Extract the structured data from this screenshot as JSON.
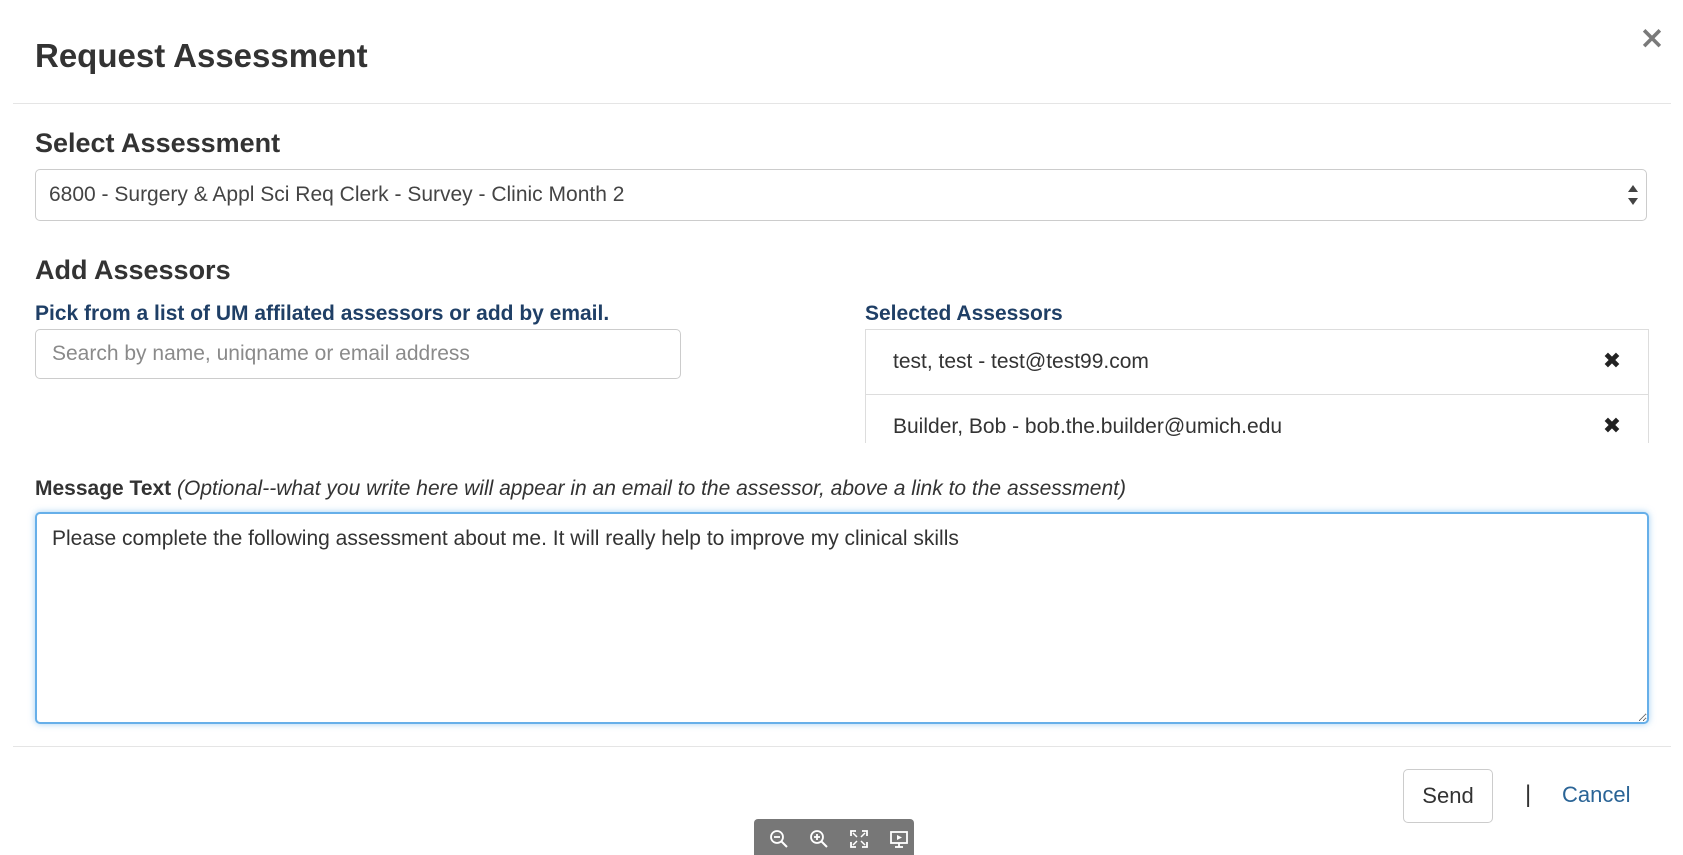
{
  "modal": {
    "title": "Request Assessment",
    "close_label": "×"
  },
  "assessment": {
    "heading": "Select Assessment",
    "selected": "6800 - Surgery & Appl Sci Req Clerk - Survey - Clinic Month 2"
  },
  "assessors": {
    "heading": "Add Assessors",
    "search_label": "Pick from a list of UM affilated assessors or add by email.",
    "search_placeholder": "Search by name, uniqname or email address",
    "selected_label": "Selected Assessors",
    "selected": [
      {
        "text": "test, test - test@test99.com",
        "remove_label": "✖"
      },
      {
        "text": "Builder, Bob - bob.the.builder@umich.edu",
        "remove_label": "✖"
      }
    ]
  },
  "message": {
    "label": "Message Text",
    "hint": "(Optional--what you write here will appear in an email to the assessor, above a link to the assessment)",
    "value": "Please complete the following assessment about me. It will really help to improve my clinical skills"
  },
  "footer": {
    "send_label": "Send",
    "separator": "|",
    "cancel_label": "Cancel"
  },
  "viewer_toolbar": {
    "icons": [
      "zoom-out-icon",
      "zoom-in-icon",
      "fullscreen-icon",
      "presentation-icon"
    ]
  },
  "colors": {
    "label_blue": "#1f3f66",
    "link_blue": "#2a6496",
    "focus_blue": "#66afe9"
  }
}
